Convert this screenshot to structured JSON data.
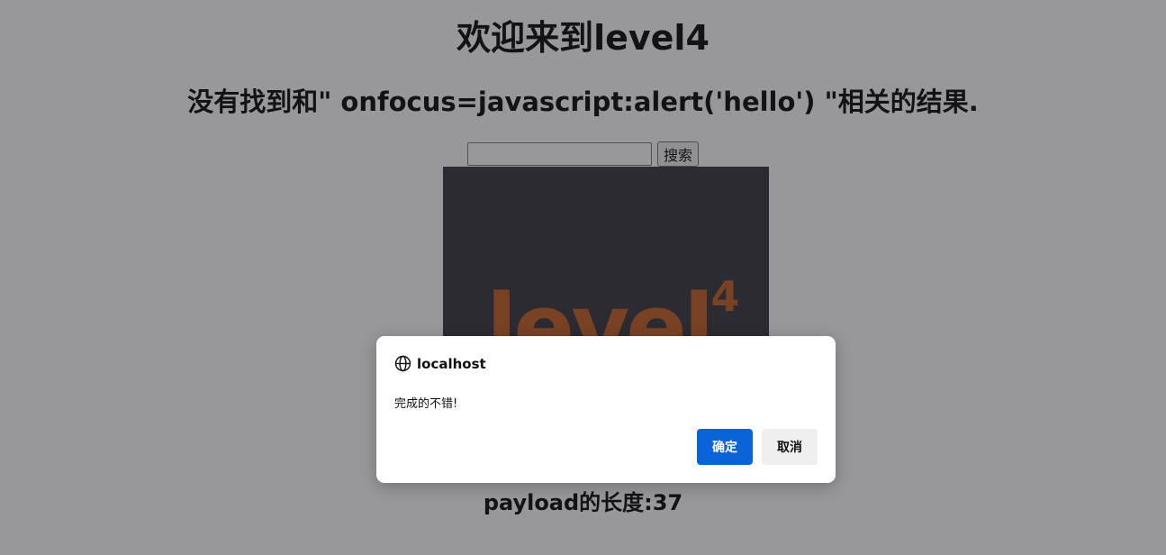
{
  "page": {
    "title": "欢迎来到level4",
    "result_heading": "没有找到和\" onfocus=javascript:alert('hello') \"相关的结果.",
    "search": {
      "value": "",
      "button_label": "搜索"
    },
    "image": {
      "logo_text": "level",
      "logo_superscript": "4"
    },
    "payload_length": "payload的长度:37"
  },
  "dialog": {
    "origin": "localhost",
    "message": "完成的不错!",
    "ok_label": "确定",
    "cancel_label": "取消",
    "icon": "globe-icon"
  },
  "colors": {
    "ok_button": "#0b63d8",
    "logo": "#c45a1b",
    "image_background": "#2f2f35"
  }
}
